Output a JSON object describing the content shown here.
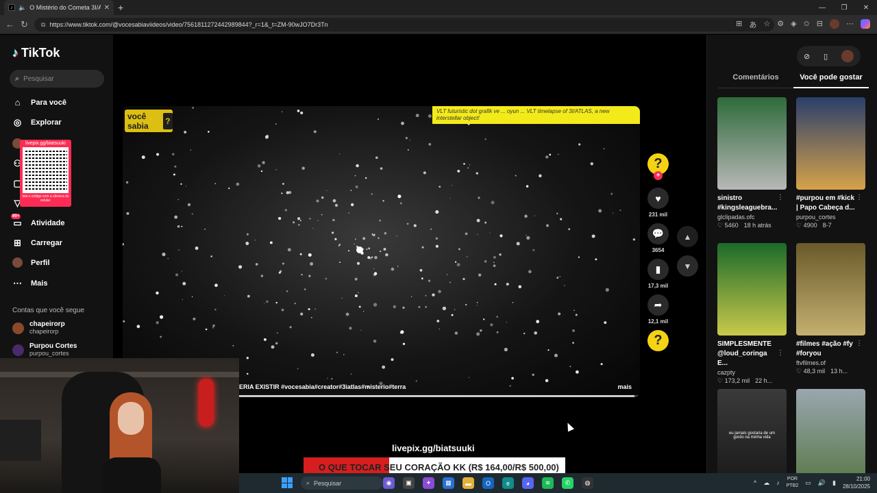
{
  "browser": {
    "tab_title": "O Mistério do Cometa 3I/AT",
    "tab_favicon": "tiktok-icon",
    "url": "https://www.tiktok.com/@vocesabiaviideos/video/7561811272442989844?_r=1&_t=ZM-90wJO7Dr3Tn"
  },
  "tiktok": {
    "logo_text": "TikTok",
    "search_placeholder": "Pesquisar",
    "menu": [
      {
        "label": "Para você",
        "icon": "home-icon"
      },
      {
        "label": "Explorar",
        "icon": "compass-icon"
      },
      {
        "label": "Atividade",
        "icon": "inbox-icon",
        "badge": "99+"
      },
      {
        "label": "Carregar",
        "icon": "plus-square-icon"
      },
      {
        "label": "Perfil",
        "icon": "avatar"
      },
      {
        "label": "Mais",
        "icon": "more-icon"
      }
    ],
    "qr_popup": {
      "top": "livepix.gg/biatsuuki",
      "bottom": "leia o código com a câmera do celular."
    },
    "following_header": "Contas que você segue",
    "following": [
      {
        "name": "chapeirorp",
        "user": "chapeirorp",
        "color": "#8a4a2a"
      },
      {
        "name": "Purpou Cortes",
        "user": "purpou_cortes",
        "color": "#4a2a6a"
      }
    ]
  },
  "video": {
    "logo": "você sabia",
    "logo_mark": "?",
    "banner_text": "VLT futuristic dot grafik ve ... oyun ... VLT timelapse of 3I/ATLAS, a new interstellar object!",
    "caption": "ERIA EXISTIR #vocesabia#creator#3iatlas#misterio#terra",
    "more_label": "mais",
    "progress": 0.99
  },
  "actions": {
    "creator_mark": "?",
    "likes": "231 mil",
    "comments": "3654",
    "saves": "17,3 mil",
    "shares": "12,1 mil"
  },
  "right_panel": {
    "tabs": [
      "Comentários",
      "Você pode gostar"
    ],
    "active_tab": 1,
    "cards": [
      {
        "title": "sinistro #kingsleaguebra...",
        "author": "glclipadas.ofc",
        "likes": "5460",
        "age": "18 h atrás",
        "thumb": [
          "#2e6b3a",
          "#b8b8b8"
        ]
      },
      {
        "title": "#purpou em #kick | Papo Cabeça d...",
        "author": "purpou_cortes",
        "likes": "4900",
        "age": "8-7",
        "thumb": [
          "#2a3f6a",
          "#d6a24a"
        ]
      },
      {
        "title": "SIMPLESMENTE @loud_coringa E...",
        "author": "cazpty",
        "likes": "173,2 mil",
        "age": "22 h...",
        "thumb": [
          "#1b6a2a",
          "#c9c94a"
        ]
      },
      {
        "title": "#filmes #ação #fy #foryou",
        "author": "ftvfilmes.of",
        "likes": "48,3 mil",
        "age": "13 h...",
        "thumb": [
          "#6a5a2a",
          "#c4b070"
        ]
      },
      {
        "title": "",
        "author": "",
        "likes": "",
        "age": "",
        "thumb": [
          "#3a3a3a",
          "#1a1a1a"
        ],
        "overlay": "eu jamais gostaria de um gordo na minha vida"
      },
      {
        "title": "",
        "author": "",
        "likes": "",
        "age": "",
        "thumb": [
          "#5a7a4a",
          "#9aa6b0"
        ]
      }
    ]
  },
  "stream": {
    "livepix": "livepix.gg/biatsuuki",
    "donation": "O QUE TOCAR SEU CORAÇÃO KK (R$ 164,00/R$ 500,00)",
    "donation_progress": 0.328
  },
  "taskbar": {
    "search_label": "Pesquisar",
    "lang_line1": "POR",
    "lang_line2": "PTB2",
    "time": "21:00",
    "date": "28/10/2025"
  }
}
